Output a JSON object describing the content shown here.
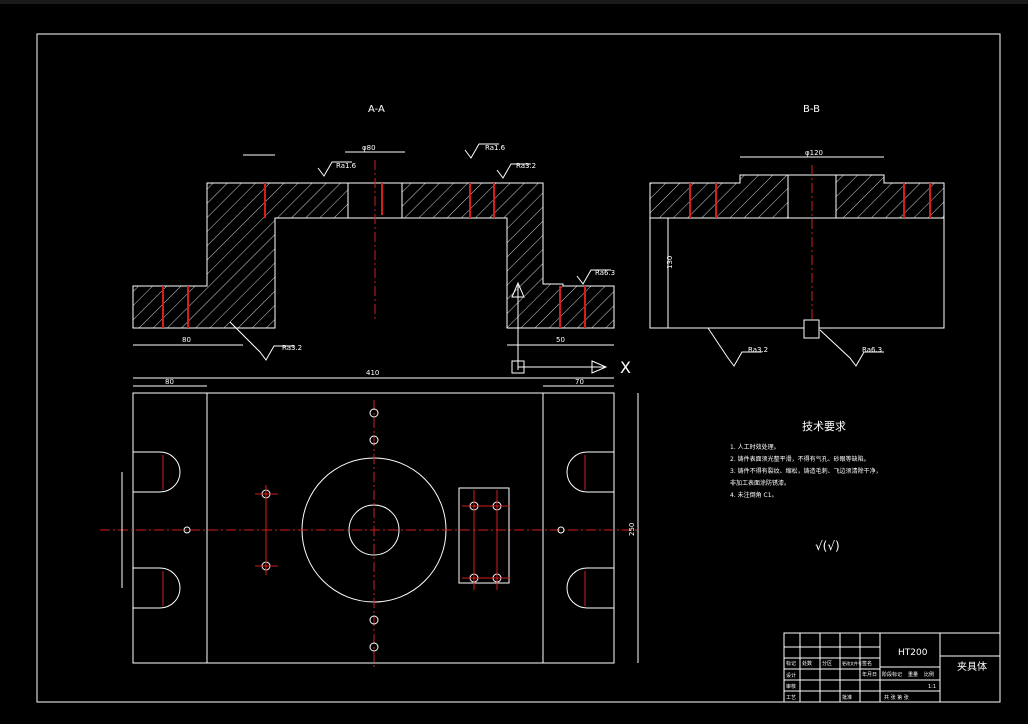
{
  "drawing": {
    "section_aa": "A-A",
    "section_bb": "B-B",
    "axis_x": "X",
    "tech_title": "技术要求",
    "tech_items": [
      "1. 人工时效处理。",
      "2. 铸件表面须光整平滑，不得有气孔、砂眼等缺陷。",
      "3. 铸件不得有裂纹、缩松，铸造毛刺、飞边须清除干净，",
      "   非加工表面涂防锈漆。",
      "4. 未注倒角 C1。"
    ],
    "roughness_note": "√(√)",
    "roughness_labels": [
      "Ra1.6",
      "Ra1.6",
      "Ra3.2",
      "Ra6.3",
      "Ra3.2",
      "Ra3.2",
      "Ra6.3"
    ],
    "dims": {
      "overall_width": "410",
      "left_offset": "80",
      "right_offset": "70",
      "height_right": "250",
      "bb_width": "φ120",
      "aa_bore": "φ80",
      "bb_height": "130",
      "left_base": "80",
      "right_base": "50"
    }
  },
  "title_block": {
    "material": "HT200",
    "part_name": "夹具体",
    "row_labels": [
      "标记",
      "设计",
      "审核",
      "工艺"
    ],
    "col_labels": [
      "处数",
      "分区",
      "更改文件号",
      "签名",
      "年月日"
    ],
    "stage_label": "阶段标记",
    "weight_label": "重量",
    "scale_label": "比例",
    "scale": "1:1",
    "sheet": "共 张 第 张",
    "approve_label": "批准"
  }
}
